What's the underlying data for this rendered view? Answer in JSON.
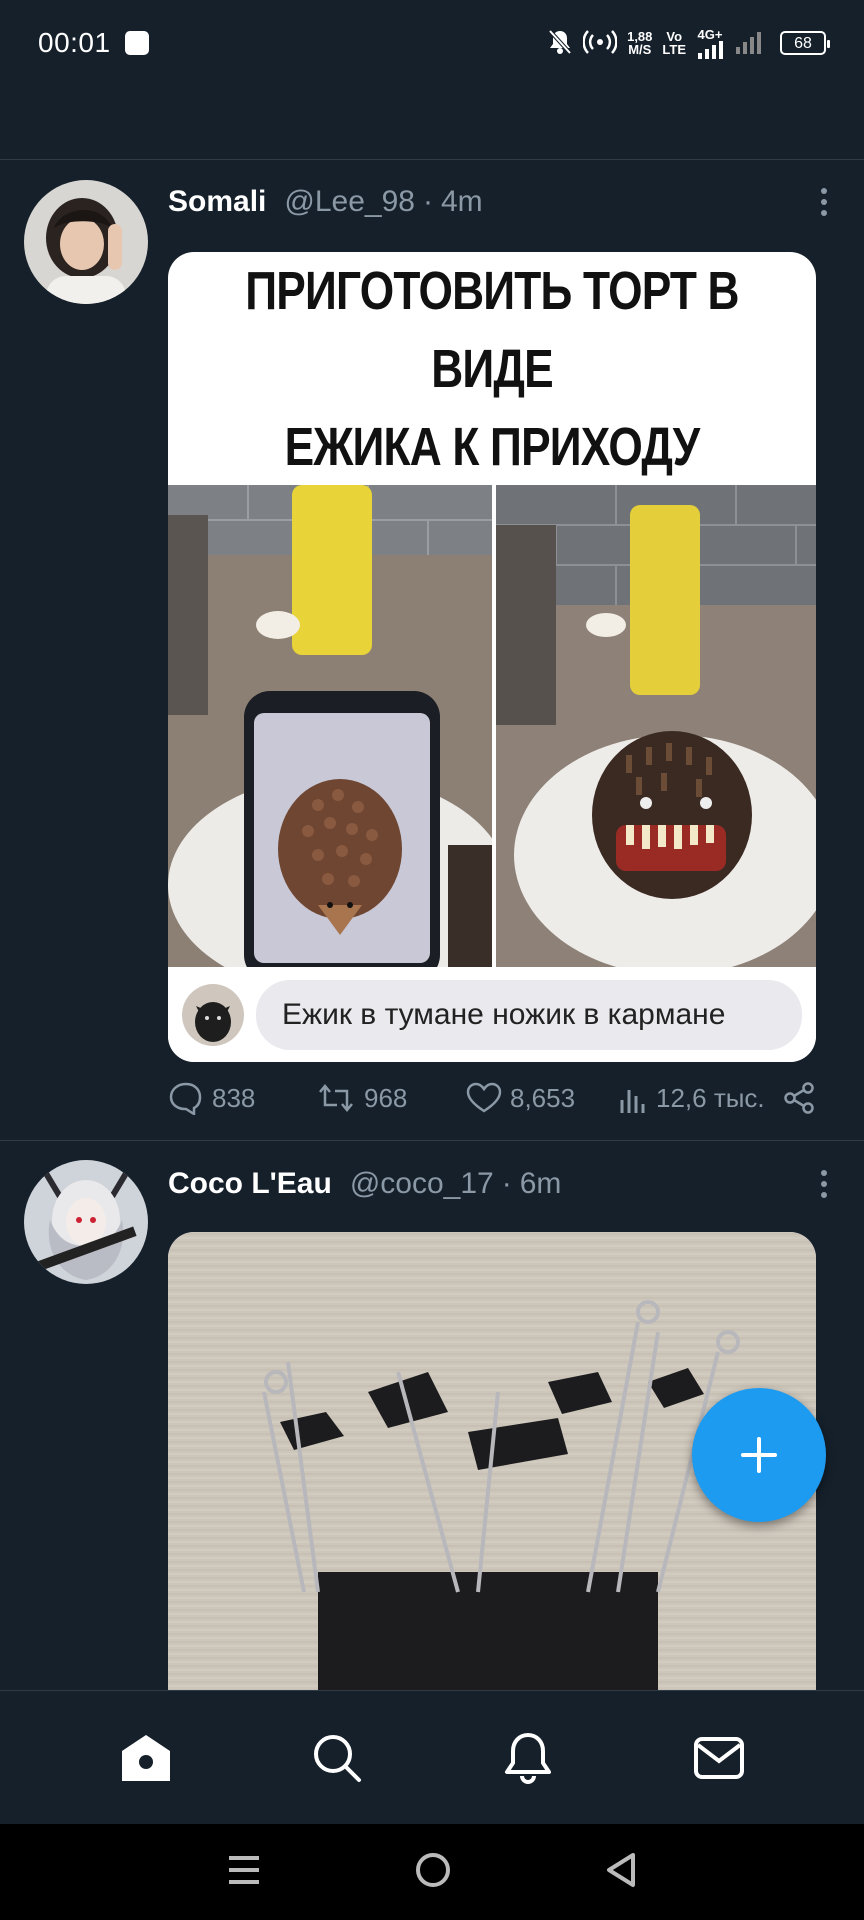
{
  "status_bar": {
    "time": "00:01",
    "speed_value": "1,88",
    "speed_unit": "M/S",
    "volte_top": "Vo",
    "volte_bottom": "LTE",
    "network": "4G+",
    "battery": "68"
  },
  "tweets": [
    {
      "name": "Somali",
      "handle": "@Lee_98",
      "separator": "·",
      "time": "4m",
      "media": {
        "title": "«МЫ ПРОСТО ХОТЕЛИ\nПРИГОТОВИТЬ ТОРТ В ВИДЕ\nЕЖИКА К ПРИХОДУ ГОСТЕЙ»",
        "comment": "Ежик в тумане ножик в кармане"
      },
      "stats": {
        "replies": "838",
        "retweets": "968",
        "likes": "8,653",
        "views": "12,6 тыс."
      }
    },
    {
      "name": "Coco L'Eau",
      "handle": "@coco_17",
      "separator": "·",
      "time": "6m"
    }
  ],
  "icons": {
    "status": [
      "mute-bell-icon",
      "hotspot-icon",
      "signal-icon",
      "battery-icon"
    ],
    "tweet": [
      "more-icon",
      "reply-icon",
      "retweet-icon",
      "like-icon",
      "views-icon",
      "share-icon"
    ],
    "fab": "plus-icon",
    "nav": [
      "home-icon",
      "search-icon",
      "notifications-icon",
      "messages-icon"
    ],
    "system": [
      "recents-icon",
      "home-circle-icon",
      "back-icon"
    ]
  },
  "colors": {
    "background": "#15202b",
    "accent": "#1d9bf0",
    "muted_text": "#8b98a5",
    "divider": "#2f3b47"
  }
}
